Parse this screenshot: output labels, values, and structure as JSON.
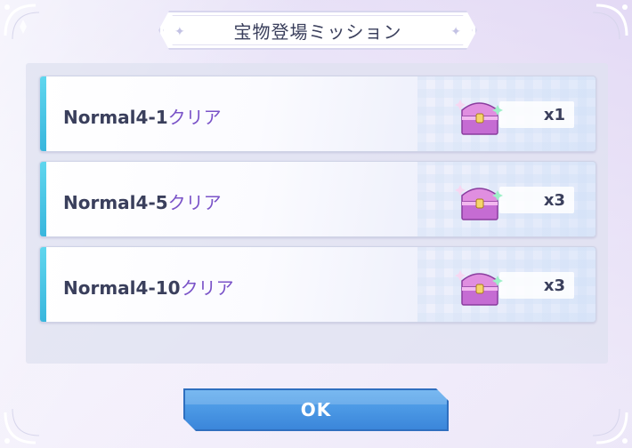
{
  "dialog": {
    "title": "宝物登場ミッション"
  },
  "missions": [
    {
      "prefix": "Normal4-1",
      "suffix": "クリア",
      "quantity": "x1",
      "reward_icon": "treasure-chest-icon"
    },
    {
      "prefix": "Normal4-5",
      "suffix": "クリア",
      "quantity": "x3",
      "reward_icon": "treasure-chest-icon"
    },
    {
      "prefix": "Normal4-10",
      "suffix": "クリア",
      "quantity": "x3",
      "reward_icon": "treasure-chest-icon"
    }
  ],
  "ok_button": {
    "label": "OK"
  },
  "colors": {
    "accent_stripe": "#39b6dd",
    "mission_suffix": "#7a53c8",
    "button": "#3b86da",
    "text": "#3a3f5c"
  }
}
